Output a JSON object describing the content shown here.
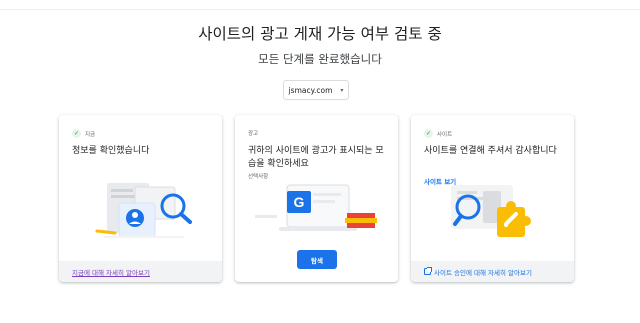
{
  "header": {
    "title": "사이트의 광고 게재 가능 여부 검토 중",
    "subtitle": "모든 단계를 완료했습니다"
  },
  "site_selector": {
    "value": "jsmacy.com",
    "caret": "▾"
  },
  "cards": [
    {
      "badge": "지금",
      "badge_icon": "check-icon",
      "text": "정보를 확인했습니다",
      "footer_link": "지금에 대해 자세히 알아보기"
    },
    {
      "badge": "광고",
      "text": "귀하의 사이트에 광고가 표시되는 모습을 확인하세요",
      "optional": "선택사항",
      "button": "탐색"
    },
    {
      "badge": "사이트",
      "badge_icon": "check-icon",
      "text": "사이트를 연결해 주셔서 감사합니다",
      "link": "사이트 보기",
      "footer_link": "사이트 승인에 대해 자세히 알아보기"
    }
  ],
  "colors": {
    "accent": "#1a73e8",
    "success": "#1e8e3e",
    "visited_link": "#7b3fbf",
    "footer_bg": "#f1f3f4"
  }
}
